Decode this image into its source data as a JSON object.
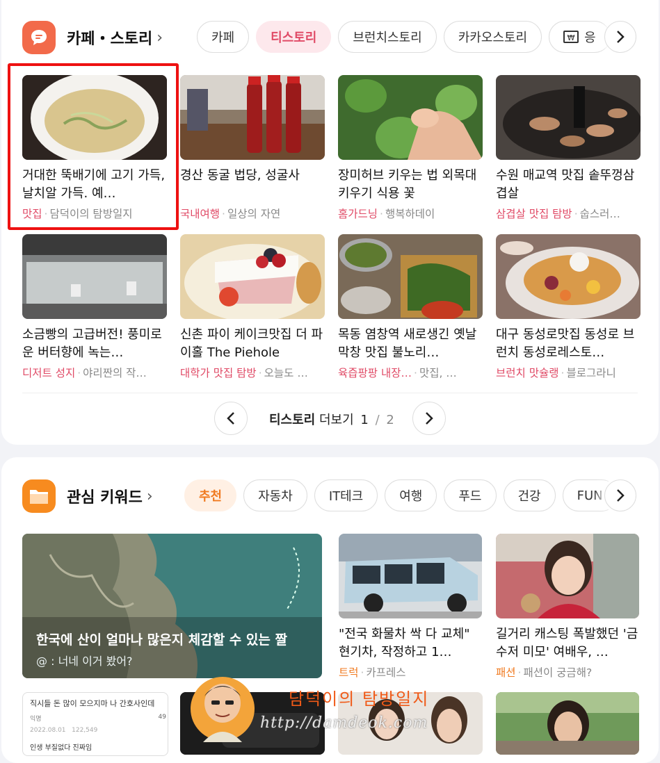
{
  "section1": {
    "title": "카페・스토리",
    "chips": [
      "카페",
      "티스토리",
      "브런치스토리",
      "카카오스토리",
      "응"
    ],
    "items": [
      {
        "title": "거대한 뚝배기에 고기 가득, 날치알 가득. 예…",
        "category": "맛집",
        "source": "담덕이의 탐방일지"
      },
      {
        "title": "경산 동굴 법당, 성굴사",
        "category": "국내여행",
        "source": "일상의 자연"
      },
      {
        "title": "장미허브 키우는 법 외목대 키우기 식용 꽃",
        "category": "홈가드닝",
        "source": "행복하데이"
      },
      {
        "title": "수원 매교역 맛집 솥뚜껑삼겹살",
        "category": "삼겹살 맛집 탐방",
        "source": "숩스러…"
      },
      {
        "title": "소금빵의 고급버전! 풍미로운 버터향에 녹는…",
        "category": "디저트 성지",
        "source": "야리짠의 작…"
      },
      {
        "title": "신촌 파이 케이크맛집 더 파이홀 The Piehole",
        "category": "대학가 맛집 탐방",
        "source": "오늘도 …"
      },
      {
        "title": "목동 염창역 새로생긴 옛날막창 맛집 불노리…",
        "category": "육즙팡팡 내장…",
        "source": "맛집, …"
      },
      {
        "title": "대구 동성로맛집 동성로 브런치 동성로레스토…",
        "category": "브런치 맛슐랭",
        "source": "블로그라니"
      }
    ],
    "pager": {
      "label": "티스토리",
      "more": "더보기",
      "current": "1",
      "total": "2"
    }
  },
  "section2": {
    "title": "관심 키워드",
    "chips": [
      "추천",
      "자동차",
      "IT테크",
      "여행",
      "푸드",
      "건강",
      "FUN"
    ],
    "feature": {
      "title": "한국에 산이 얼마나 많은지 체감할 수 있는 짤",
      "subtitle": "@ : 너네 이거 봤어?"
    },
    "items": [
      {
        "title": "\"전국 화물차 싹 다 교체\" 현기차, 작정하고 1…",
        "category": "트럭",
        "source": "카프레스"
      },
      {
        "title": "길거리 캐스팅 폭발했던 '금수저 미모' 여배우, …",
        "category": "패션",
        "source": "패션이 궁금해?"
      }
    ],
    "bottom_thumb_text": {
      "line1": "직시들 돈 많이 모으지마 나 간호사인데",
      "line2": "익명",
      "line3": "2022.08.01",
      "line4": "122,549",
      "line5": "인생 부질없다 진짜임",
      "count": "49"
    }
  },
  "watermark": {
    "title": "담덕이의 탐방일지",
    "url": "http://damdeok.com"
  },
  "colors": {
    "accent_pink": "#e04a66",
    "accent_orange": "#f07a20",
    "highlight": "#ee1111"
  }
}
